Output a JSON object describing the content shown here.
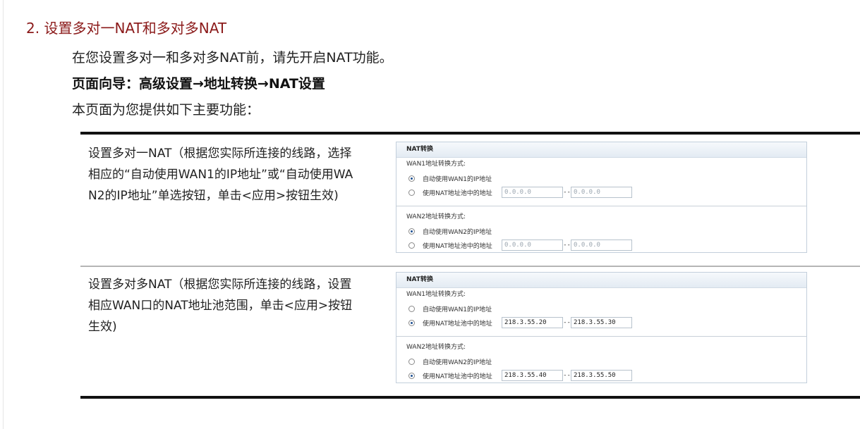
{
  "heading": "2. 设置多对一NAT和多对多NAT",
  "intro": {
    "line1": "在您设置多对一和多对多NAT前，请先开启NAT功能。",
    "line2": "页面向导：高级设置→地址转换→NAT设置",
    "line3": "本页面为您提供如下主要功能："
  },
  "rows": [
    {
      "desc_lines": [
        "设置多对一NAT（根据您实际所连接的线路，选择",
        "相应的“自动使用WAN1的IP地址”或“自动使用WA",
        "N2的IP地址”单选按钮，单击<应用>按钮生效)"
      ],
      "panel": {
        "title": "NAT转换",
        "wan1_label": "WAN1地址转换方式:",
        "wan1_auto": "自动使用WAN1的IP地址",
        "wan1_pool": "使用NAT地址池中的地址",
        "wan1_auto_selected": true,
        "wan1_start": "0.0.0.0",
        "wan1_end": "0.0.0.0",
        "wan2_label": "WAN2地址转换方式:",
        "wan2_auto": "自动使用WAN2的IP地址",
        "wan2_pool": "使用NAT地址池中的地址",
        "wan2_auto_selected": true,
        "wan2_start": "0.0.0.0",
        "wan2_end": "0.0.0.0",
        "dash": "--"
      }
    },
    {
      "desc_lines": [
        "设置多对多NAT（根据您实际所连接的线路，设置",
        "相应WAN口的NAT地址池范围，单击<应用>按钮",
        "生效)"
      ],
      "panel": {
        "title": "NAT转换",
        "wan1_label": "WAN1地址转换方式:",
        "wan1_auto": "自动使用WAN1的IP地址",
        "wan1_pool": "使用NAT地址池中的地址",
        "wan1_auto_selected": false,
        "wan1_start": "218.3.55.20",
        "wan1_end": "218.3.55.30",
        "wan2_label": "WAN2地址转换方式:",
        "wan2_auto": "自动使用WAN2的IP地址",
        "wan2_pool": "使用NAT地址池中的地址",
        "wan2_auto_selected": false,
        "wan2_start": "218.3.55.40",
        "wan2_end": "218.3.55.50",
        "dash": "--"
      }
    }
  ]
}
